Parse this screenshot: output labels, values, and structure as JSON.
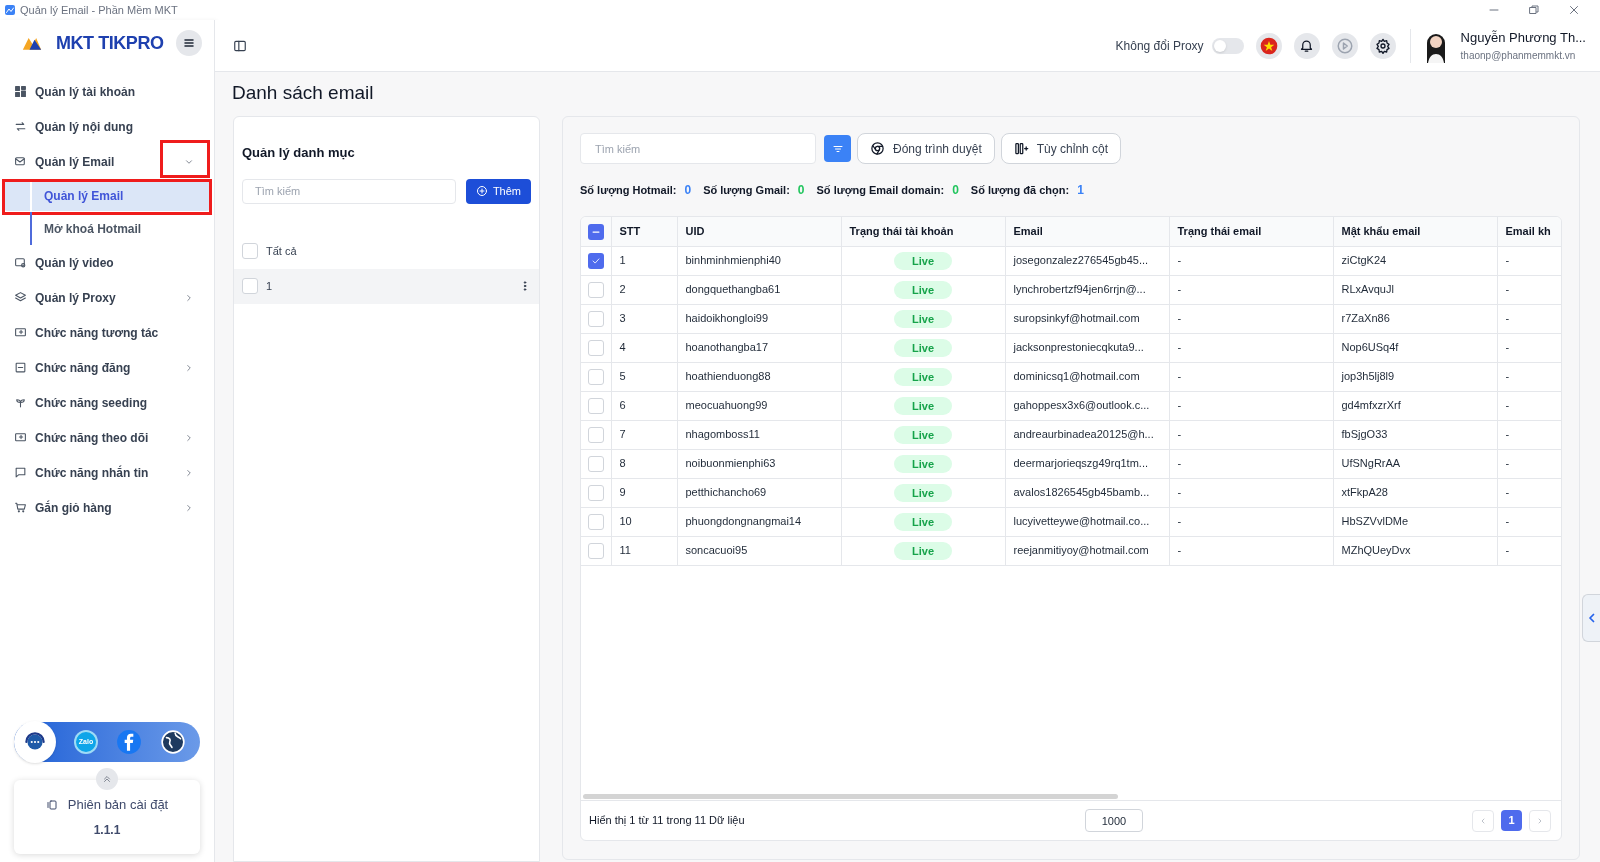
{
  "window": {
    "title": "Quản lý Email - Phần Mềm MKT"
  },
  "sidebar": {
    "logo": "MKT TIKPRO",
    "items": [
      {
        "label": "Quản lý tài khoản"
      },
      {
        "label": "Quản lý nội dung"
      },
      {
        "label": "Quản lý Email",
        "expanded": true,
        "annotated_chevron": true,
        "children": [
          {
            "label": "Quản lý Email",
            "selected": true,
            "annotated": true
          },
          {
            "label": "Mở khoá Hotmail",
            "selected": false,
            "annotated": false
          }
        ]
      },
      {
        "label": "Quản lý video"
      },
      {
        "label": "Quản lý Proxy",
        "expanded": false
      },
      {
        "label": "Chức năng tương tác"
      },
      {
        "label": "Chức năng đăng",
        "expanded": false
      },
      {
        "label": "Chức năng seeding"
      },
      {
        "label": "Chức năng theo dõi",
        "expanded": false
      },
      {
        "label": "Chức năng nhắn tin",
        "expanded": false
      },
      {
        "label": "Gắn giỏ hàng",
        "expanded": false
      }
    ],
    "social": {
      "zalo": "Zalo"
    },
    "version": {
      "label": "Phiên bản cài đặt",
      "number": "1.1.1"
    }
  },
  "header": {
    "proxy_label": "Không đổi Proxy",
    "proxy_on": false,
    "user_name": "Nguyễn Phương Th...",
    "user_email": "thaonp@phanmemmkt.vn"
  },
  "page_title": "Danh sách email",
  "categories": {
    "title": "Quản lý danh mục",
    "search_placeholder": "Tìm kiếm",
    "add_button": "Thêm",
    "items": [
      {
        "label": "Tất cả",
        "checked": false,
        "selected": false
      },
      {
        "label": "1",
        "checked": false,
        "selected": true
      }
    ]
  },
  "toolbar": {
    "search_placeholder": "Tìm kiếm",
    "close_browser": "Đóng trình duyệt",
    "customize_columns": "Tùy chỉnh cột"
  },
  "stats": [
    {
      "label": "Số lượng Hotmail:",
      "value": "0",
      "color": "#3b82f6"
    },
    {
      "label": "Số lượng Gmail:",
      "value": "0",
      "color": "#22c55e"
    },
    {
      "label": "Số lượng Email domain:",
      "value": "0",
      "color": "#22c55e"
    },
    {
      "label": "Số lượng đã chọn:",
      "value": "1",
      "color": "#3b82f6"
    }
  ],
  "table": {
    "header_checkbox": {
      "checked": true,
      "indeterminate": true
    },
    "columns": [
      "STT",
      "UID",
      "Trạng thái tài khoản",
      "Email",
      "Trạng thái email",
      "Mật khẩu email",
      "Email kh"
    ],
    "rows": [
      {
        "checked": true,
        "cells": [
          "1",
          "binhminhmienphi40",
          "Live",
          "josegonzalez276545gb45...",
          "-",
          "ziCtgK24",
          "-"
        ]
      },
      {
        "checked": false,
        "cells": [
          "2",
          "dongquethangba61",
          "Live",
          "lynchrobertzf94jen6rrjn@...",
          "-",
          "RLxAvquJl",
          "-"
        ]
      },
      {
        "checked": false,
        "cells": [
          "3",
          "haidoikhongloi99",
          "Live",
          "suropsinkyf@hotmail.com",
          "-",
          "r7ZaXn86",
          "-"
        ]
      },
      {
        "checked": false,
        "cells": [
          "4",
          "hoanothangba17",
          "Live",
          "jacksonprestoniecqkuta9...",
          "-",
          "Nop6USq4f",
          "-"
        ]
      },
      {
        "checked": false,
        "cells": [
          "5",
          "hoathienduong88",
          "Live",
          "dominicsq1@hotmail.com",
          "-",
          "jop3h5lj8l9",
          "-"
        ]
      },
      {
        "checked": false,
        "cells": [
          "6",
          "meocuahuong99",
          "Live",
          "gahoppesx3x6@outlook.c...",
          "-",
          "gd4mfxzrXrf",
          "-"
        ]
      },
      {
        "checked": false,
        "cells": [
          "7",
          "nhagomboss11",
          "Live",
          "andreaurbinadea20125@h...",
          "-",
          "fbSjgO33",
          "-"
        ]
      },
      {
        "checked": false,
        "cells": [
          "8",
          "noibuonmienphi63",
          "Live",
          "deermarjorieqszg49rq1tm...",
          "-",
          "UfSNgRrAA",
          "-"
        ]
      },
      {
        "checked": false,
        "cells": [
          "9",
          "petthichancho69",
          "Live",
          "avalos1826545gb45bamb...",
          "-",
          "xtFkpA28",
          "-"
        ]
      },
      {
        "checked": false,
        "cells": [
          "10",
          "phuongdongnangmai14",
          "Live",
          "lucyivetteywe@hotmail.co...",
          "-",
          "HbSZVvlDMe",
          "-"
        ]
      },
      {
        "checked": false,
        "cells": [
          "11",
          "soncacuoi95",
          "Live",
          "reejanmitiyoy@hotmail.com",
          "-",
          "MZhQUeyDvx",
          "-"
        ]
      }
    ]
  },
  "footer": {
    "summary": "Hiển thị 1 từ 11 trong 11 Dữ liệu",
    "page_size": "1000",
    "pages": [
      {
        "label": "1",
        "selected": true
      }
    ]
  }
}
